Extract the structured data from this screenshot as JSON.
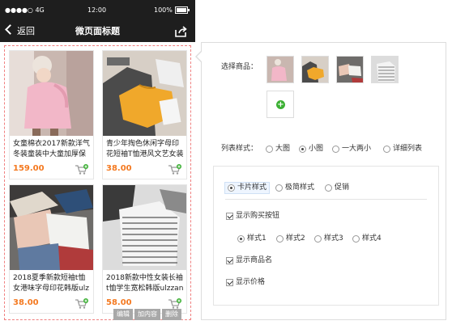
{
  "status_bar": {
    "carrier": "●●●●○ 4G",
    "time": "12:00",
    "battery": "100%"
  },
  "nav": {
    "back_label": "返回",
    "title": "微页面标题"
  },
  "products": [
    {
      "name": "女童棉衣2017新款洋气冬装童装中大童加厚保",
      "price": "159.00"
    },
    {
      "name": "青少年掏色休闲字母印花短袖T恤港风文艺女装",
      "price": "38.00"
    },
    {
      "name": "2018夏季新款短袖t恤女港味字母印花韩版ulz",
      "price": "38.00"
    },
    {
      "name": "2018新款中性女装长袖t恤学生宽松韩版ulzzan",
      "price": "58.00"
    }
  ],
  "item_toolbar": {
    "edit": "编辑",
    "add": "加内容",
    "delete": "删除"
  },
  "settings": {
    "select_products_label": "选择商品：",
    "add_icon": "plus-icon",
    "list_style_label": "列表样式：",
    "list_styles": [
      "大图",
      "小图",
      "一大两小",
      "详细列表"
    ],
    "list_style_selected": "小图",
    "card_styles": [
      "卡片样式",
      "极简样式",
      "促销"
    ],
    "card_style_selected": "卡片样式",
    "show_buy_button": "显示购买按钮",
    "button_styles": [
      "样式1",
      "样式2",
      "样式3",
      "样式4"
    ],
    "button_style_selected": "样式1",
    "show_name": "显示商品名",
    "show_price": "显示价格"
  },
  "colors": {
    "price": "#f47920",
    "cart_badge": "#3cb034",
    "dashed_border": "#f08080",
    "header_bg": "#1e1e1e"
  }
}
